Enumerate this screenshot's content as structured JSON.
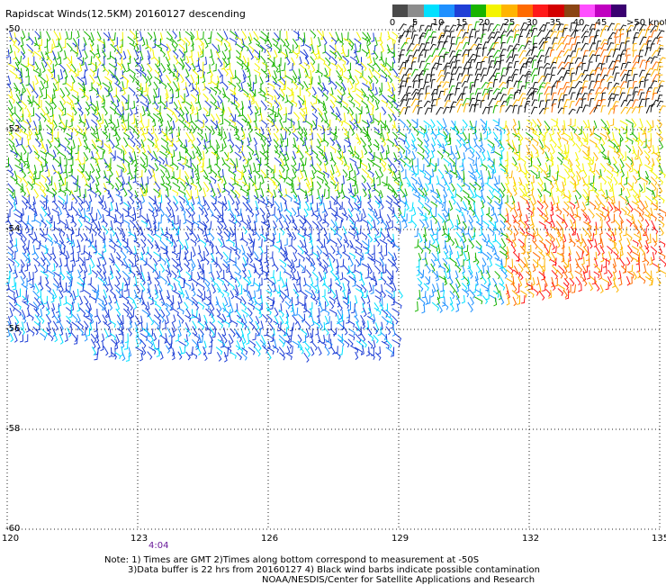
{
  "title": "Rapidscat Winds(12.5KM) 20160127 descending",
  "colorbar": {
    "labels": [
      "0",
      "5",
      "10",
      "15",
      "20",
      "25",
      "30",
      "35",
      "40",
      "45",
      ">50 knots"
    ],
    "colors": [
      "#4a4a4a",
      "#8c8c8c",
      "#00e0ff",
      "#1e90ff",
      "#1f3fd6",
      "#19b400",
      "#f4f400",
      "#ffb400",
      "#ff6a00",
      "#ff1a1a",
      "#d40000",
      "#8b4513",
      "#ff4fff",
      "#c000c0",
      "#3a0070"
    ]
  },
  "axes": {
    "lat_labels": [
      "-50",
      "-52",
      "-54",
      "-56",
      "-58",
      "-60"
    ],
    "lon_labels": [
      "120",
      "123",
      "126",
      "129",
      "132",
      "135"
    ]
  },
  "time_label": "4:04",
  "notes": {
    "line1": "Note: 1) Times are GMT 2)Times along bottom correspond to measurement at -50S",
    "line2": "3)Data buffer is 22 hrs from 20160127 4) Black wind barbs indicate possible contamination",
    "line3": "NOAA/NESDIS/Center for Satellite Applications and Research"
  }
}
